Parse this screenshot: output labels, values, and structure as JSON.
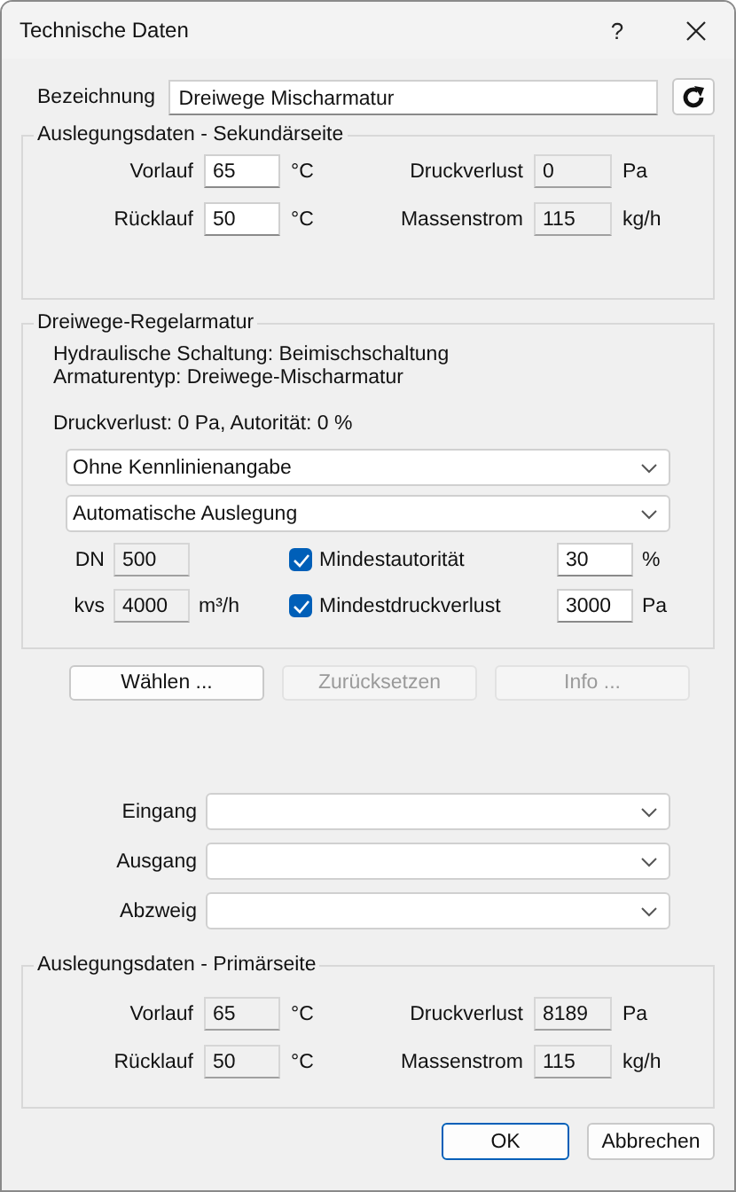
{
  "window": {
    "title": "Technische Daten",
    "help": "?"
  },
  "designation": {
    "label": "Bezeichnung",
    "value": "Dreiwege Mischarmatur"
  },
  "secondary": {
    "title": "Auslegungsdaten - Sekundärseite",
    "fields": [
      {
        "label": "Vorlauf",
        "value": "65",
        "unit": "°C",
        "readonly": false
      },
      {
        "label": "Druckverlust",
        "value": "0",
        "unit": "Pa",
        "readonly": true
      },
      {
        "label": "Rücklauf",
        "value": "50",
        "unit": "°C",
        "readonly": false
      },
      {
        "label": "Massenstrom",
        "value": "115",
        "unit": "kg/h",
        "readonly": true
      }
    ]
  },
  "valve": {
    "title": "Dreiwege-Regelarmatur",
    "info_lines": [
      "Hydraulische Schaltung: Beimischschaltung",
      "Armaturentyp: Dreiwege-Mischarmatur"
    ],
    "summary": "Druckverlust: 0 Pa, Autorität: 0 %",
    "dropdowns": [
      {
        "value": "Ohne Kennlinienangabe"
      },
      {
        "value": "Automatische Auslegung"
      }
    ],
    "params": [
      {
        "label": "DN",
        "value": "500",
        "readonly": true,
        "option": {
          "label": "Mindestautorität",
          "checked": true,
          "value": "30",
          "unit": "%"
        }
      },
      {
        "label": "kvs",
        "value": "4000",
        "unit": "m³/h",
        "readonly": true,
        "option": {
          "label": "Mindestdruckverlust",
          "checked": true,
          "value": "3000",
          "unit": "Pa"
        }
      }
    ]
  },
  "actions": [
    {
      "label": "Wählen ...",
      "disabled": false
    },
    {
      "label": "Zurücksetzen",
      "disabled": true
    },
    {
      "label": "Info ...",
      "disabled": true
    }
  ],
  "connections": [
    {
      "label": "Eingang"
    },
    {
      "label": "Ausgang"
    },
    {
      "label": "Abzweig"
    }
  ],
  "primary": {
    "title": "Auslegungsdaten - Primärseite",
    "fields": [
      {
        "label": "Vorlauf",
        "value": "65",
        "unit": "°C",
        "readonly": true
      },
      {
        "label": "Druckverlust",
        "value": "8189",
        "unit": "Pa",
        "readonly": true
      },
      {
        "label": "Rücklauf",
        "value": "50",
        "unit": "°C",
        "readonly": true
      },
      {
        "label": "Massenstrom",
        "value": "115",
        "unit": "kg/h",
        "readonly": true
      }
    ]
  },
  "footer": [
    {
      "label": "OK",
      "default": true
    },
    {
      "label": "Abbrechen",
      "default": false
    }
  ]
}
